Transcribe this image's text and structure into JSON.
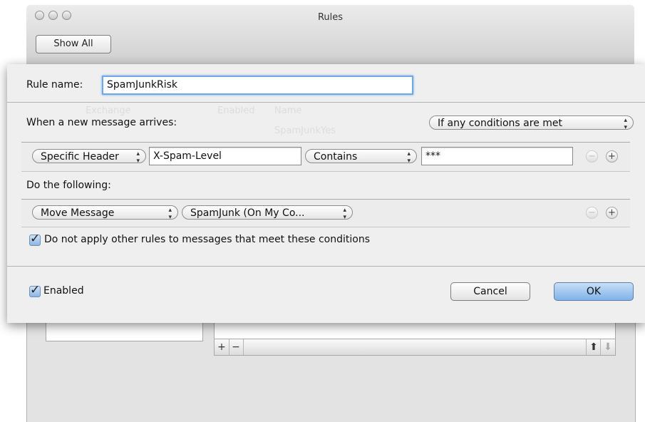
{
  "window": {
    "title": "Rules",
    "show_all_label": "Show All"
  },
  "background": {
    "ghost_account": "Exchange",
    "ghost_header_enabled": "Enabled",
    "ghost_header_name": "Name",
    "ghost_rule": "SpamJunkYes",
    "list_footer": {
      "add": "+",
      "remove": "−",
      "up": "⬆",
      "down": "⬇"
    }
  },
  "sheet": {
    "rule_name_label": "Rule name:",
    "rule_name_value": "SpamJunkRisk",
    "when_label": "When a new message arrives:",
    "condition_match": "If any conditions are met",
    "condition": {
      "field": "Specific Header",
      "header_value": "X-Spam-Level",
      "operator": "Contains",
      "match_value": "***"
    },
    "do_label": "Do the following:",
    "action": {
      "type": "Move Message",
      "target": "SpamJunk (On My Co..."
    },
    "minus": "−",
    "plus": "+",
    "stop_rules_label": "Do not apply other rules to messages that meet these conditions",
    "stop_rules_checked": true,
    "enabled_label": "Enabled",
    "enabled_checked": true,
    "cancel_label": "Cancel",
    "ok_label": "OK"
  },
  "colors": {
    "accent": "#7fb2e9",
    "focus_ring": "#6fa8e8"
  }
}
